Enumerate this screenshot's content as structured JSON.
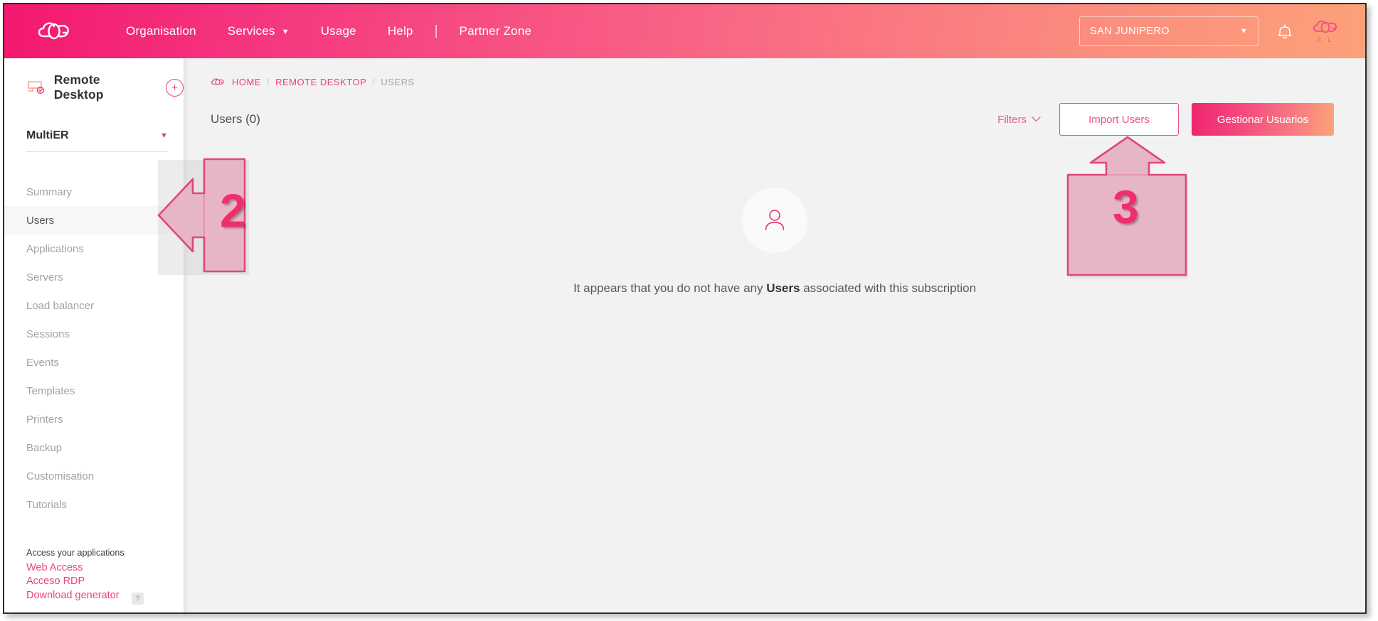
{
  "header": {
    "logo_icon": "cloud-logo-icon",
    "nav": [
      {
        "label": "Organisation",
        "has_caret": false
      },
      {
        "label": "Services",
        "has_caret": true,
        "caret": "▼"
      },
      {
        "label": "Usage",
        "has_caret": false
      },
      {
        "label": "Help",
        "has_caret": false
      }
    ],
    "separator": "|",
    "partner_zone": "Partner Zone",
    "org_selector": {
      "value": "SAN JUNIPERO",
      "caret": "▼"
    },
    "notification_icon": "bell-icon",
    "avatar": {
      "icon": "cloud-logo-icon",
      "tag": "E L"
    }
  },
  "sidebar": {
    "service_icon": "remote-desktop-icon",
    "title": "Remote Desktop",
    "add_label": "+",
    "subscription": {
      "name": "MultiER",
      "caret": "▼"
    },
    "items": [
      {
        "label": "Summary",
        "active": false
      },
      {
        "label": "Users",
        "active": true
      },
      {
        "label": "Applications",
        "active": false
      },
      {
        "label": "Servers",
        "active": false
      },
      {
        "label": "Load balancer",
        "active": false
      },
      {
        "label": "Sessions",
        "active": false
      },
      {
        "label": "Events",
        "active": false
      },
      {
        "label": "Templates",
        "active": false
      },
      {
        "label": "Printers",
        "active": false
      },
      {
        "label": "Backup",
        "active": false
      },
      {
        "label": "Customisation",
        "active": false
      },
      {
        "label": "Tutorials",
        "active": false
      }
    ],
    "access": {
      "heading": "Access your applications",
      "links": [
        {
          "label": "Web Access"
        },
        {
          "label": "Acceso RDP"
        },
        {
          "label": "Download generator"
        }
      ]
    },
    "help_chip": "?"
  },
  "main": {
    "breadcrumb": {
      "home_icon": "cloud-logo-icon",
      "items": [
        {
          "label": "HOME",
          "current": false
        },
        {
          "label": "REMOTE DESKTOP",
          "current": false
        },
        {
          "label": "USERS",
          "current": true
        }
      ],
      "separator": "/"
    },
    "page_title": "Users (0)",
    "filters": {
      "label": "Filters",
      "caret": "⌄"
    },
    "import_button": "Import Users",
    "manage_button": "Gestionar Usuarios",
    "empty_state": {
      "icon": "user-avatar-icon",
      "text_before": "It appears that you do not have any ",
      "text_bold": "Users",
      "text_after": " associated with this subscription"
    }
  },
  "annotations": [
    {
      "id": "step-2",
      "number": "2",
      "direction": "left",
      "target": "sidebar-item-users"
    },
    {
      "id": "step-3",
      "number": "3",
      "direction": "up",
      "target": "import-users-button"
    }
  ],
  "colors": {
    "brand_pink": "#ef2e6d",
    "brand_coral": "#fca179",
    "link_pink": "#e8457a",
    "sidebar_muted": "#a3a3a3",
    "content_bg": "#f2f2f2",
    "annotation_fill": "#e7b6c4",
    "annotation_stroke": "#e0467f"
  }
}
